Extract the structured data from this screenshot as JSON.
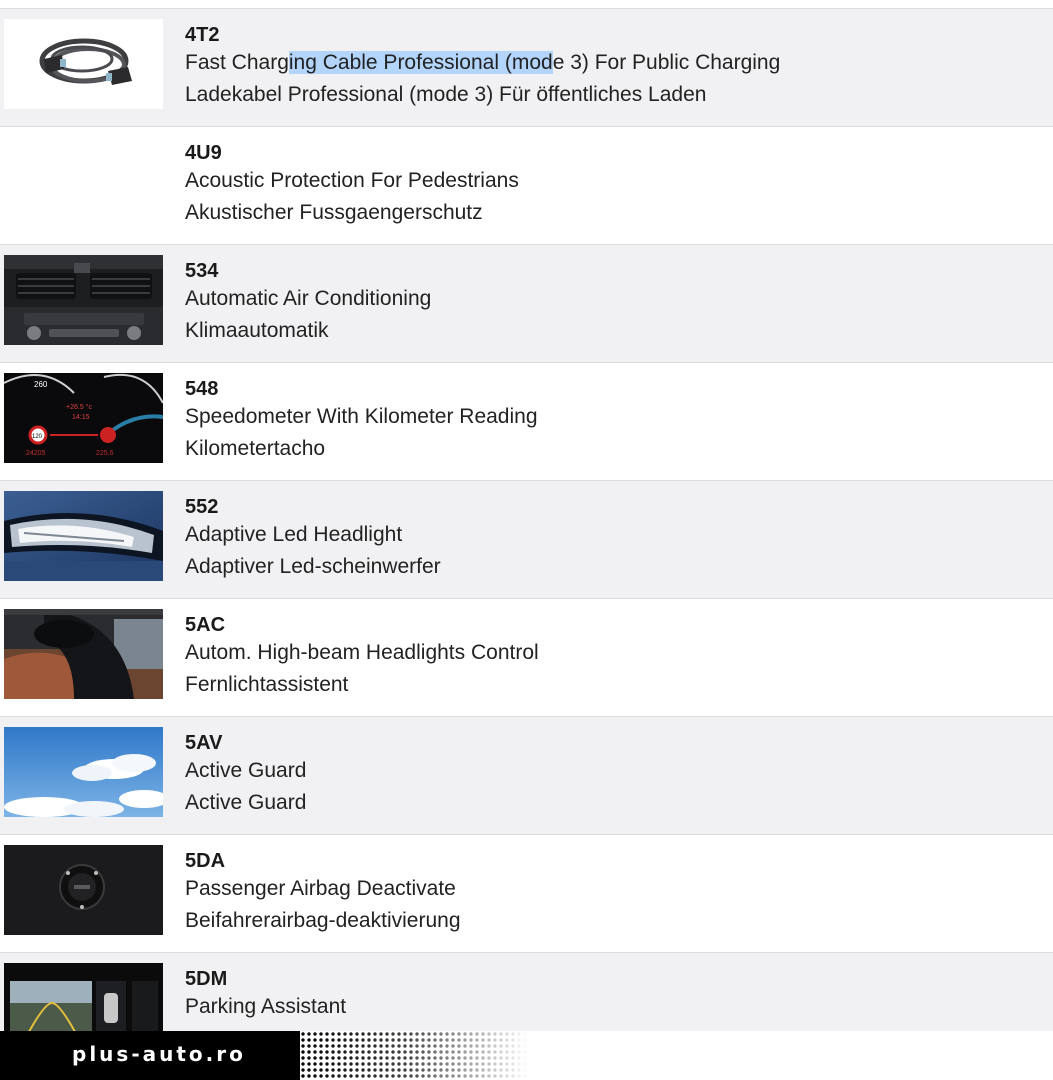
{
  "options": [
    {
      "code": "4T2",
      "en_before": "Fast Charg",
      "en_highlight": "ing Cable Professional (mod",
      "en_after": "e 3) For Public Charging",
      "de": "Ladekabel Professional (mode 3) Für öffentliches Laden",
      "thumbnail": "charging-cable-image"
    },
    {
      "code": "4U9",
      "en": "Acoustic Protection For Pedestrians",
      "de": "Akustischer Fussgaengerschutz"
    },
    {
      "code": "534",
      "en": "Automatic Air Conditioning",
      "de": "Klimaautomatik",
      "thumbnail": "climate-control-panel-image"
    },
    {
      "code": "548",
      "en": "Speedometer With Kilometer Reading",
      "de": "Kilometertacho",
      "thumbnail": "instrument-cluster-image",
      "thumbnail_text": {
        "speed_mark": "260",
        "temp": "+26.5 °c",
        "time": "14:15",
        "limit_sign": "120",
        "odo_left": "24205",
        "odo_right": "225.6"
      }
    },
    {
      "code": "552",
      "en": "Adaptive Led Headlight",
      "de": "Adaptiver Led-scheinwerfer",
      "thumbnail": "headlight-image"
    },
    {
      "code": "5AC",
      "en": "Autom. High-beam Headlights Control",
      "de": "Fernlichtassistent",
      "thumbnail": "rear-view-mirror-camera-image"
    },
    {
      "code": "5AV",
      "en": "Active Guard",
      "de": "Active Guard",
      "thumbnail": "sky-image"
    },
    {
      "code": "5DA",
      "en": "Passenger Airbag Deactivate",
      "de": "Beifahrerairbag-deaktivierung",
      "thumbnail": "airbag-key-switch-image"
    },
    {
      "code": "5DM",
      "en": "Parking Assistant",
      "de": "",
      "thumbnail": "parking-camera-display-image"
    }
  ],
  "footer": {
    "brand": "plus-auto.ro"
  },
  "colors": {
    "row_alt_bg": "#f1f1f3",
    "divider": "#dcdcdc",
    "selection_highlight": "#b3d4fb",
    "brand_bar": "#000000"
  }
}
